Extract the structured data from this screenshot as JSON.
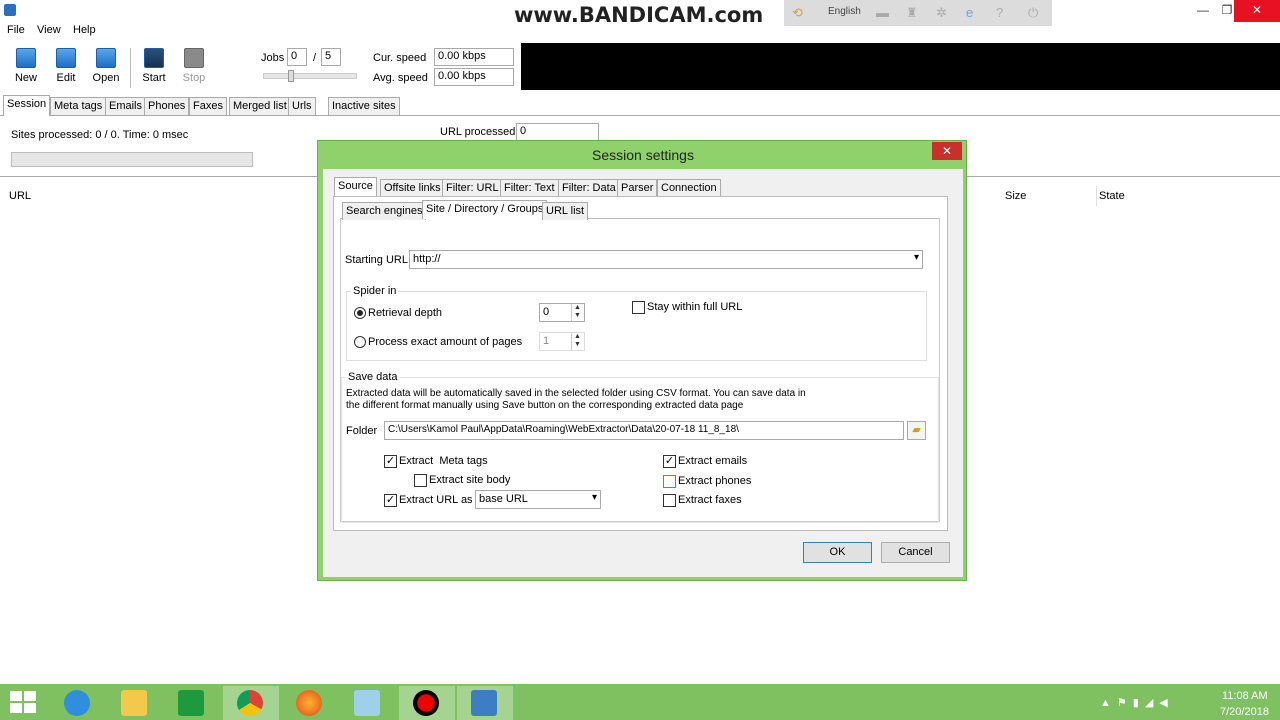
{
  "watermark": "www.BANDICAM.com",
  "bandicam_bar": {
    "language": "English"
  },
  "window_title": "",
  "menu": [
    "File",
    "View",
    "Help"
  ],
  "toolbar": {
    "new": "New",
    "edit": "Edit",
    "open": "Open",
    "start": "Start",
    "stop": "Stop",
    "jobs_label": "Jobs",
    "jobs_value": "0",
    "jobs_sep": "/",
    "jobs_max": "5",
    "cur_speed_label": "Cur. speed",
    "cur_speed_value": "0.00 kbps",
    "avg_speed_label": "Avg. speed",
    "avg_speed_value": "0.00 kbps"
  },
  "main_tabs": [
    "Session",
    "Meta tags",
    "Emails",
    "Phones",
    "Faxes",
    "Merged list",
    "Urls",
    "Inactive sites"
  ],
  "session": {
    "sites_processed": "Sites processed: 0 / 0. Time: 0 msec",
    "url_processed_label": "URL processed",
    "url_processed_value": "0",
    "columns": {
      "url": "URL",
      "size": "Size",
      "state": "State"
    }
  },
  "dialog": {
    "title": "Session settings",
    "tabs": [
      "Source",
      "Offsite links",
      "Filter: URL",
      "Filter: Text",
      "Filter: Data",
      "Parser",
      "Connection"
    ],
    "subtabs": [
      "Search engines",
      "Site / Directory / Groups",
      "URL list"
    ],
    "starting_url_label": "Starting URL",
    "starting_url_value": "http://",
    "spider_in": {
      "legend": "Spider in",
      "retrieval_depth": "Retrieval depth",
      "retrieval_value": "0",
      "exact_pages": "Process exact amount of pages",
      "exact_value": "1",
      "stay_within": "Stay within full URL"
    },
    "save_data": {
      "legend": "Save data",
      "desc1": "Extracted data will be automatically saved in the selected folder using CSV format. You can save data in",
      "desc2": "the different format manually using Save button on the corresponding extracted data page",
      "folder_label": "Folder",
      "folder_value": "C:\\Users\\Kamol Paul\\AppData\\Roaming\\WebExtractor\\Data\\20-07-18 11_8_18\\",
      "extract_meta": "Extract  Meta tags",
      "extract_body": "Extract site body",
      "extract_url_as": "Extract URL as",
      "url_as_value": "base URL",
      "extract_emails": "Extract emails",
      "extract_phones": "Extract phones",
      "extract_faxes": "Extract faxes"
    },
    "ok": "OK",
    "cancel": "Cancel"
  },
  "tray": {
    "time": "11:08 AM",
    "date": "7/20/2018"
  },
  "colors": {
    "dialog_frame": "#8fd16a",
    "taskbar": "#7fc160",
    "close_red": "#e81123"
  }
}
